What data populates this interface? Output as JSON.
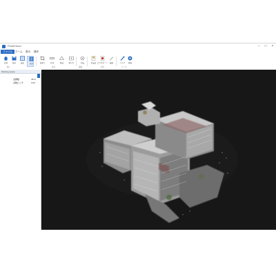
{
  "window": {
    "title": "PointCloud",
    "controls": {
      "minimize": "–",
      "maximize": "□",
      "close": "×"
    }
  },
  "menu": {
    "tabs": [
      {
        "label": "ファイル",
        "active": true
      },
      {
        "label": "ホーム"
      },
      {
        "label": "表示"
      },
      {
        "label": "操作"
      }
    ]
  },
  "ribbon": {
    "buttons": [
      {
        "label": "点群",
        "icon": "home-icon",
        "color": "#2b6cc4"
      },
      {
        "label": "保存",
        "icon": "save-icon",
        "color": "#2b6cc4"
      },
      {
        "label": "設定",
        "icon": "layers-icon",
        "color": "#2b6cc4"
      },
      {
        "label": "表示",
        "icon": "grid-icon",
        "color": "#2b6cc4",
        "active": true
      },
      {
        "label": "切取り",
        "icon": "crop-icon",
        "color": "#777777"
      },
      {
        "label": "計測",
        "icon": "ruler-icon",
        "color": "#777777"
      },
      {
        "label": "断面",
        "icon": "section-icon",
        "color": "#777777"
      },
      {
        "label": "間引き",
        "icon": "thin-icon",
        "color": "#777777"
      },
      {
        "label": "回転",
        "icon": "rotate-icon",
        "color": "#777777"
      },
      {
        "label": "色設定",
        "icon": "color-icon",
        "color": "#c9a227"
      },
      {
        "label": "エクスポート",
        "icon": "export-icon",
        "color": "#c0392b"
      },
      {
        "label": "編集",
        "icon": "edit-icon",
        "color": "#777777"
      },
      {
        "label": "ヘルプ",
        "icon": "help-icon",
        "color": "#2b6cc4"
      },
      {
        "label": "情報",
        "icon": "info-icon",
        "color": "#2b6cc4"
      }
    ],
    "groups": [
      "開く",
      "表示",
      "編集",
      "出力",
      "ツール"
    ]
  },
  "panel": {
    "title": "Working space",
    "rows": [
      {
        "name": "点群数",
        "value": "4574"
      },
      {
        "name": "点数ピッチ",
        "value": "0.05"
      }
    ]
  },
  "colors": {
    "accent": "#2b6cc4",
    "viewport_bg": "#171717"
  }
}
